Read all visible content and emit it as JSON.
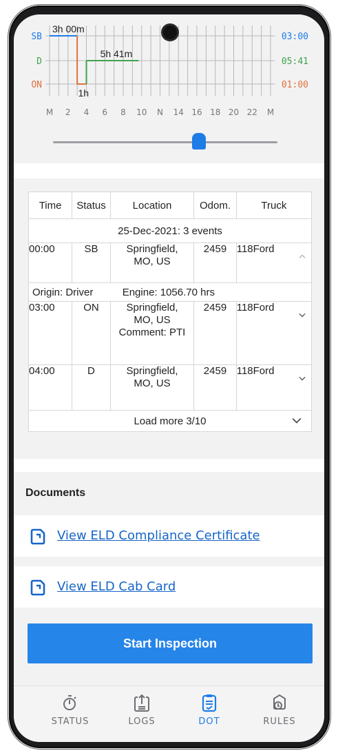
{
  "chart": {
    "status_labels": {
      "sb": "SB",
      "d": "D",
      "on": "ON"
    },
    "totals": {
      "sb": "03:00",
      "d": "05:41",
      "on": "01:00"
    },
    "annotations": {
      "sb": "3h 00m",
      "d": "5h 41m",
      "on": "1h"
    },
    "hour_labels": [
      "M",
      "2",
      "4",
      "6",
      "8",
      "10",
      "N",
      "14",
      "16",
      "18",
      "20",
      "22",
      "M"
    ],
    "colors": {
      "sb": "#1e7ce6",
      "d": "#3fa34d",
      "on": "#e0703a",
      "grid": "#b8b8bc"
    },
    "slider_value": 0.65
  },
  "table": {
    "headers": [
      "Time",
      "Status",
      "Location",
      "Odom.",
      "Truck"
    ],
    "date_row": "25-Dec-2021: 3 events",
    "rows": [
      {
        "time": "00:00",
        "status": "SB",
        "location": "Springfield,\nMO, US",
        "odom": "2459",
        "truck": "118Ford",
        "expanded": true
      },
      {
        "time": "03:00",
        "status": "ON",
        "location": "Springfield,\nMO, US\nComment: PTI",
        "odom": "2459",
        "truck": "118Ford",
        "expanded": false
      },
      {
        "time": "04:00",
        "status": "D",
        "location": "Springfield,\nMO, US",
        "odom": "2459",
        "truck": "118Ford",
        "expanded": false
      }
    ],
    "origin": "Origin: Driver",
    "engine": "Engine: 1056.70 hrs",
    "load_more": "Load more 3/10"
  },
  "documents": {
    "title": "Documents",
    "links": [
      "View ELD Compliance Certificate",
      "View ELD Cab Card"
    ]
  },
  "start_button": "Start Inspection",
  "nav": [
    {
      "label": "STATUS",
      "icon": "stopwatch-icon",
      "active": false
    },
    {
      "label": "LOGS",
      "icon": "logs-upload-icon",
      "active": false
    },
    {
      "label": "DOT",
      "icon": "clipboard-check-icon",
      "active": true
    },
    {
      "label": "RULES",
      "icon": "rules-book-icon",
      "active": false
    }
  ]
}
